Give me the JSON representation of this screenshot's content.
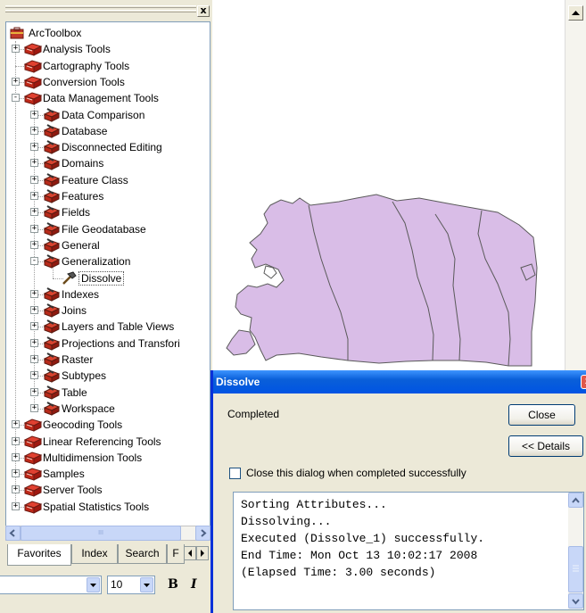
{
  "toolbox": {
    "title_close": "x",
    "tree": [
      {
        "label": "ArcToolbox",
        "level": 0,
        "expander": "",
        "icon": "toolbox"
      },
      {
        "label": "Analysis Tools",
        "level": 1,
        "expander": "+",
        "icon": "red-toolbox"
      },
      {
        "label": "Cartography Tools",
        "level": 1,
        "expander": "",
        "icon": "red-toolbox"
      },
      {
        "label": "Conversion Tools",
        "level": 1,
        "expander": "+",
        "icon": "red-toolbox"
      },
      {
        "label": "Data Management Tools",
        "level": 1,
        "expander": "-",
        "icon": "red-toolbox"
      },
      {
        "label": "Data Comparison",
        "level": 2,
        "expander": "+",
        "icon": "toolset"
      },
      {
        "label": "Database",
        "level": 2,
        "expander": "+",
        "icon": "toolset"
      },
      {
        "label": "Disconnected Editing",
        "level": 2,
        "expander": "+",
        "icon": "toolset"
      },
      {
        "label": "Domains",
        "level": 2,
        "expander": "+",
        "icon": "toolset"
      },
      {
        "label": "Feature Class",
        "level": 2,
        "expander": "+",
        "icon": "toolset"
      },
      {
        "label": "Features",
        "level": 2,
        "expander": "+",
        "icon": "toolset"
      },
      {
        "label": "Fields",
        "level": 2,
        "expander": "+",
        "icon": "toolset"
      },
      {
        "label": "File Geodatabase",
        "level": 2,
        "expander": "+",
        "icon": "toolset"
      },
      {
        "label": "General",
        "level": 2,
        "expander": "+",
        "icon": "toolset"
      },
      {
        "label": "Generalization",
        "level": 2,
        "expander": "-",
        "icon": "toolset"
      },
      {
        "label": "Dissolve",
        "level": 3,
        "expander": "",
        "icon": "hammer",
        "selected": true
      },
      {
        "label": "Indexes",
        "level": 2,
        "expander": "+",
        "icon": "toolset"
      },
      {
        "label": "Joins",
        "level": 2,
        "expander": "+",
        "icon": "toolset"
      },
      {
        "label": "Layers and Table Views",
        "level": 2,
        "expander": "+",
        "icon": "toolset"
      },
      {
        "label": "Projections and Transfori",
        "level": 2,
        "expander": "+",
        "icon": "toolset"
      },
      {
        "label": "Raster",
        "level": 2,
        "expander": "+",
        "icon": "toolset"
      },
      {
        "label": "Subtypes",
        "level": 2,
        "expander": "+",
        "icon": "toolset"
      },
      {
        "label": "Table",
        "level": 2,
        "expander": "+",
        "icon": "toolset"
      },
      {
        "label": "Workspace",
        "level": 2,
        "expander": "+",
        "icon": "toolset"
      },
      {
        "label": "Geocoding Tools",
        "level": 1,
        "expander": "+",
        "icon": "red-toolbox"
      },
      {
        "label": "Linear Referencing Tools",
        "level": 1,
        "expander": "+",
        "icon": "red-toolbox"
      },
      {
        "label": "Multidimension Tools",
        "level": 1,
        "expander": "+",
        "icon": "red-toolbox"
      },
      {
        "label": "Samples",
        "level": 1,
        "expander": "+",
        "icon": "red-toolbox"
      },
      {
        "label": "Server Tools",
        "level": 1,
        "expander": "+",
        "icon": "red-toolbox"
      },
      {
        "label": "Spatial Statistics Tools",
        "level": 1,
        "expander": "+",
        "icon": "red-toolbox"
      }
    ],
    "hscroll": {
      "thumb": "III"
    },
    "tabs": {
      "favorites": "Favorites",
      "index": "Index",
      "search": "Search",
      "partial": "F"
    },
    "fontbar": {
      "size": "10",
      "bold": "B",
      "italic": "I"
    }
  },
  "dialog": {
    "title": "Dissolve",
    "close_glyph": "x",
    "status": "Completed",
    "close_label": "Close",
    "details_label": "<< Details",
    "checkbox_label": "Close this dialog when completed successfully",
    "checkbox_checked": false,
    "log": [
      "Sorting Attributes...",
      "Dissolving...",
      "Executed (Dissolve_1) successfully.",
      "End Time: Mon Oct 13 10:02:17 2008",
      "(Elapsed Time: 3.00 seconds)"
    ]
  },
  "colors": {
    "polygon_fill": "#d9bde7",
    "polygon_stroke": "#5a5a5a",
    "titlebar": "#0054e3",
    "panel": "#ece9d8"
  }
}
